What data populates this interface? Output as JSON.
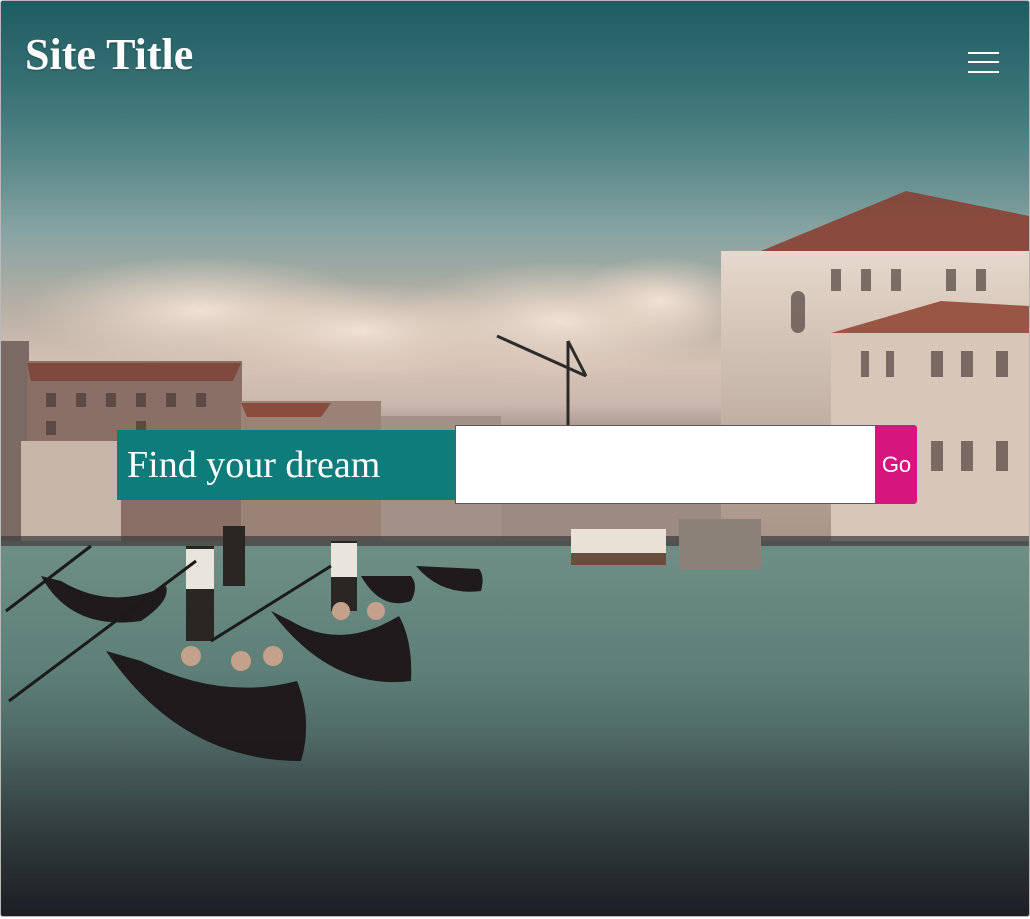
{
  "header": {
    "site_title": "Site Title",
    "menu_icon": "hamburger-menu-icon"
  },
  "search": {
    "label": "Find your dream",
    "value": "",
    "placeholder": "",
    "button_label": "Go"
  },
  "colors": {
    "label_background": "#0e7c7b",
    "button_background": "#d6157f",
    "text": "#ffffff"
  }
}
